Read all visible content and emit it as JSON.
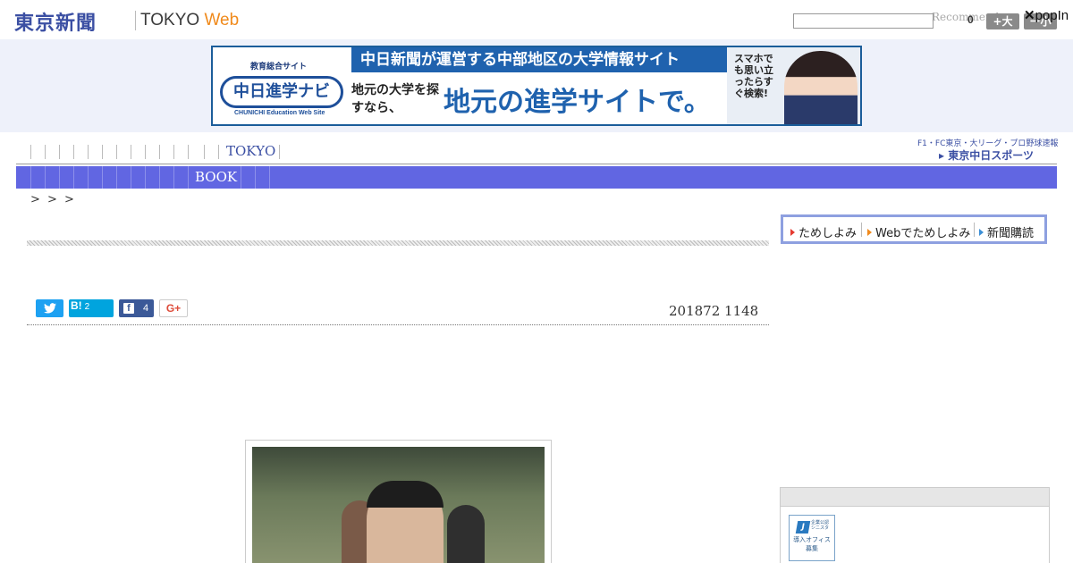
{
  "header": {
    "logo_jp": "東京新聞",
    "logo_en_main": "TOKYO ",
    "logo_en_accent": "Web",
    "search_placeholder": "",
    "recommend_label": "Recommend",
    "recommend_count": "0",
    "font_larger": "+大",
    "font_smaller": "ー小",
    "popin_x": "✕",
    "popin_label": "popIn"
  },
  "banner": {
    "small_label": "教育総合サイト",
    "logo_text": "中日進学ナビ",
    "logo_en": "CHUNICHI Education Web Site",
    "top_text": "中日新聞が運営する中部地区の大学情報サイト",
    "sub_text": "地元の大学を探すなら、",
    "main_text": "地元の進学サイトで。",
    "vertical_text": "スマホでも思い立ったらすぐ検索!"
  },
  "nav": {
    "row1_label": "TOKYO",
    "row2_label": "BOOK",
    "tcs_sub": "F1・FC東京・大リーグ・プロ野球速報",
    "tcs_logo": "▸ 東京中日スポーツ"
  },
  "breadcrumb": "> > >",
  "promo": {
    "item1": "ためしよみ",
    "item2": "Webでためしよみ",
    "item3": "新聞購読",
    "colors": {
      "item1": "#e53a2f",
      "item2": "#f08a1c",
      "item3": "#3b8fd6"
    }
  },
  "share": {
    "twitter_icon": "twitter-bird-icon",
    "hatena_label": "B!",
    "hatena_count": "2",
    "facebook_letter": "f",
    "facebook_count": "4",
    "gplus_label": "G+"
  },
  "article": {
    "date": "201872 1148"
  },
  "sidebar": {
    "ad_logo": "J",
    "ad_small": "企業公認 シニスタ",
    "ad_text": "導入オフィス 募集"
  }
}
